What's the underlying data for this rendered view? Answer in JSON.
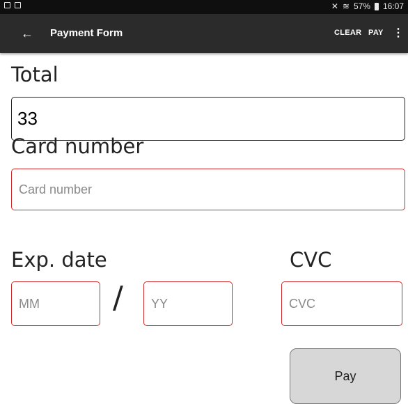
{
  "status_bar": {
    "battery": "57%",
    "time": "16:07"
  },
  "app_bar": {
    "back_icon": "arrow-left-icon",
    "title": "Payment Form",
    "clear_label": "CLEAR",
    "pay_label": "PAY",
    "more_icon": "more-vert-icon"
  },
  "form": {
    "total": {
      "label": "Total",
      "value": "33"
    },
    "card_number": {
      "label": "Card number",
      "placeholder": "Card number"
    },
    "exp_date": {
      "label": "Exp. date",
      "month_placeholder": "MM",
      "year_placeholder": "YY",
      "separator": "/"
    },
    "cvc": {
      "label": "CVC",
      "placeholder": "CVC"
    },
    "submit_label": "Pay"
  },
  "colors": {
    "status_bar": "#0f0f0f",
    "app_bar": "#2b2b2b",
    "error_border": "#cc2a2a",
    "button_bg": "#d7d7d7"
  }
}
